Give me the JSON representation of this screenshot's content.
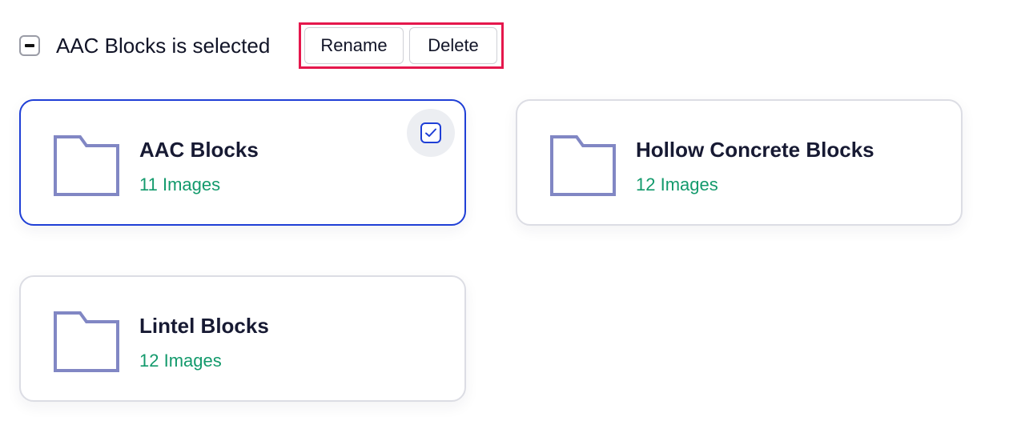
{
  "selection_bar": {
    "status_text": "AAC Blocks is selected",
    "rename_label": "Rename",
    "delete_label": "Delete"
  },
  "folders": [
    {
      "name": "AAC Blocks",
      "count_text": "11 Images",
      "selected": true,
      "icon": "folder-icon"
    },
    {
      "name": "Hollow Concrete Blocks",
      "count_text": "12 Images",
      "selected": false,
      "icon": "folder-icon"
    },
    {
      "name": "Lintel Blocks",
      "count_text": "12 Images",
      "selected": false,
      "icon": "folder-icon"
    }
  ],
  "colors": {
    "selected_border": "#1f3fd6",
    "highlight_box": "#e5174c",
    "count_text": "#139a6c",
    "folder_icon": "#8187c4"
  }
}
